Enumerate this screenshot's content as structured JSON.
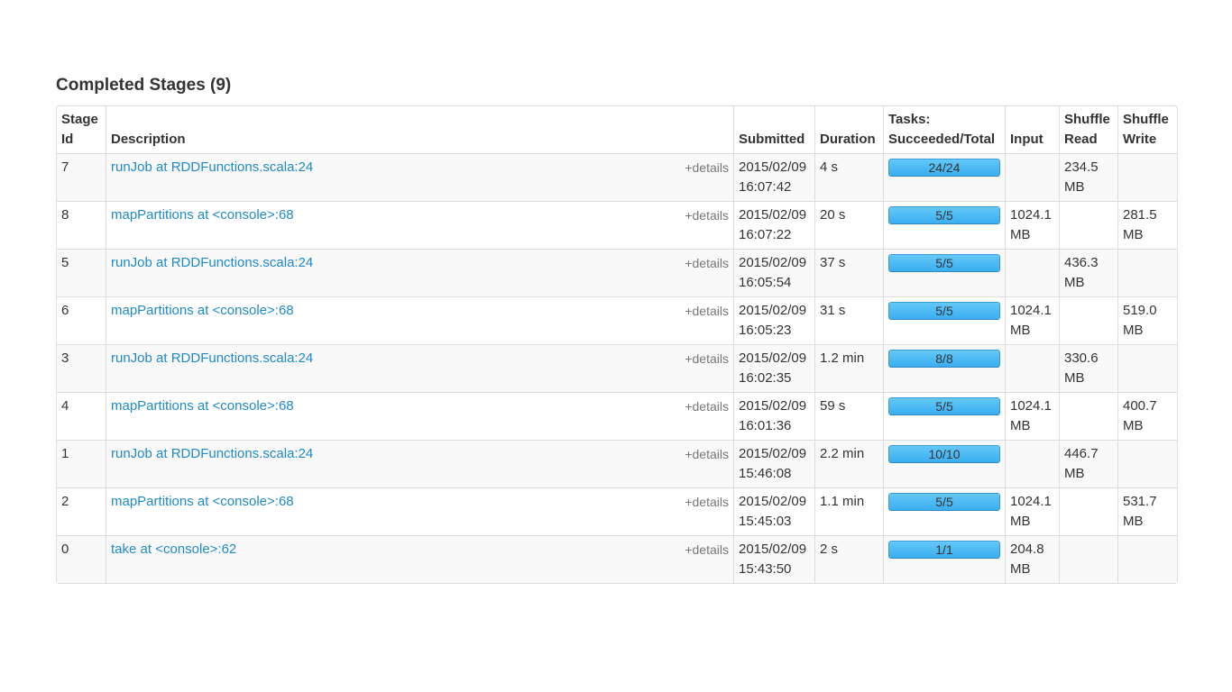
{
  "title": "Completed Stages (9)",
  "columns": {
    "stage_id": "Stage Id",
    "description": "Description",
    "submitted": "Submitted",
    "duration": "Duration",
    "tasks": "Tasks: Succeeded/Total",
    "input": "Input",
    "shuffle_read": "Shuffle Read",
    "shuffle_write": "Shuffle Write"
  },
  "details_label": "+details",
  "accent_color": "#1f8ac7",
  "progress_color": "#4ab7f4",
  "rows": [
    {
      "id": "7",
      "description": "runJob at RDDFunctions.scala:24",
      "submitted": "2015/02/09 16:07:42",
      "duration": "4 s",
      "tasks": "24/24",
      "progress": 1.0,
      "input": "",
      "shuffle_read": "234.5 MB",
      "shuffle_write": ""
    },
    {
      "id": "8",
      "description": "mapPartitions at <console>:68",
      "submitted": "2015/02/09 16:07:22",
      "duration": "20 s",
      "tasks": "5/5",
      "progress": 1.0,
      "input": "1024.1 MB",
      "shuffle_read": "",
      "shuffle_write": "281.5 MB"
    },
    {
      "id": "5",
      "description": "runJob at RDDFunctions.scala:24",
      "submitted": "2015/02/09 16:05:54",
      "duration": "37 s",
      "tasks": "5/5",
      "progress": 1.0,
      "input": "",
      "shuffle_read": "436.3 MB",
      "shuffle_write": ""
    },
    {
      "id": "6",
      "description": "mapPartitions at <console>:68",
      "submitted": "2015/02/09 16:05:23",
      "duration": "31 s",
      "tasks": "5/5",
      "progress": 1.0,
      "input": "1024.1 MB",
      "shuffle_read": "",
      "shuffle_write": "519.0 MB"
    },
    {
      "id": "3",
      "description": "runJob at RDDFunctions.scala:24",
      "submitted": "2015/02/09 16:02:35",
      "duration": "1.2 min",
      "tasks": "8/8",
      "progress": 1.0,
      "input": "",
      "shuffle_read": "330.6 MB",
      "shuffle_write": ""
    },
    {
      "id": "4",
      "description": "mapPartitions at <console>:68",
      "submitted": "2015/02/09 16:01:36",
      "duration": "59 s",
      "tasks": "5/5",
      "progress": 1.0,
      "input": "1024.1 MB",
      "shuffle_read": "",
      "shuffle_write": "400.7 MB"
    },
    {
      "id": "1",
      "description": "runJob at RDDFunctions.scala:24",
      "submitted": "2015/02/09 15:46:08",
      "duration": "2.2 min",
      "tasks": "10/10",
      "progress": 1.0,
      "input": "",
      "shuffle_read": "446.7 MB",
      "shuffle_write": ""
    },
    {
      "id": "2",
      "description": "mapPartitions at <console>:68",
      "submitted": "2015/02/09 15:45:03",
      "duration": "1.1 min",
      "tasks": "5/5",
      "progress": 1.0,
      "input": "1024.1 MB",
      "shuffle_read": "",
      "shuffle_write": "531.7 MB"
    },
    {
      "id": "0",
      "description": "take at <console>:62",
      "submitted": "2015/02/09 15:43:50",
      "duration": "2 s",
      "tasks": "1/1",
      "progress": 1.0,
      "input": "204.8 MB",
      "shuffle_read": "",
      "shuffle_write": ""
    }
  ]
}
